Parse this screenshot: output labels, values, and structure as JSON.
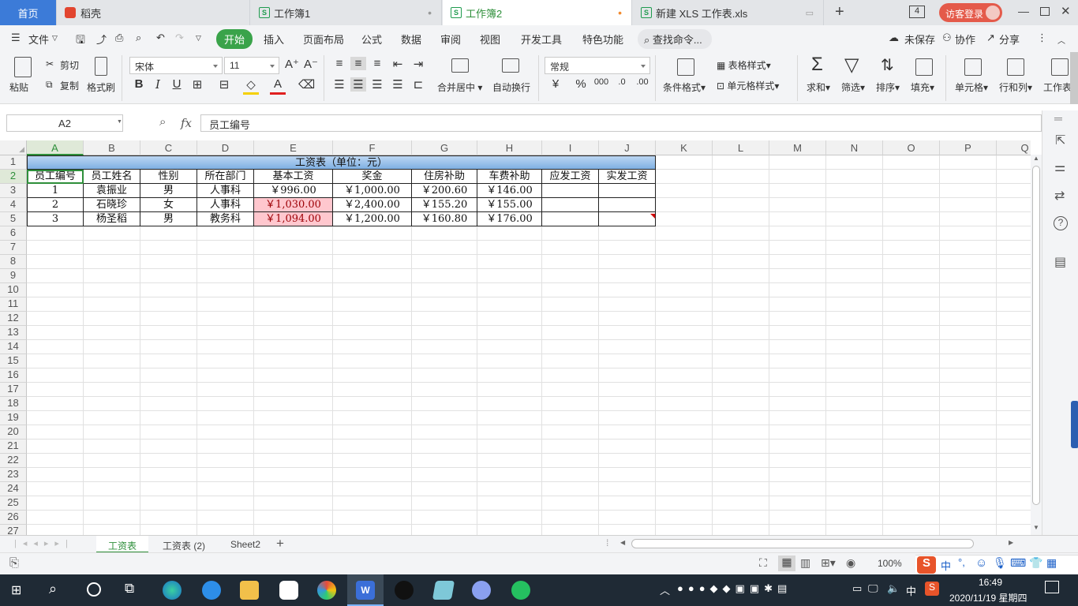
{
  "tabs": {
    "home": "首页",
    "daoke": "稻壳",
    "book1": "工作簿1",
    "book2": "工作簿2",
    "xls": "新建 XLS 工作表.xls",
    "plus": "+",
    "count": "4",
    "login": "访客登录"
  },
  "menu": {
    "file": "文件",
    "start": "开始",
    "insert": "插入",
    "layout": "页面布局",
    "formula": "公式",
    "data": "数据",
    "review": "审阅",
    "view": "视图",
    "dev": "开发工具",
    "special": "特色功能",
    "search": "查找命令...",
    "unsaved": "未保存",
    "collab": "协作",
    "share": "分享"
  },
  "ribbon": {
    "paste": "粘贴",
    "cut": "剪切",
    "copy": "复制",
    "painter": "格式刷",
    "font": "宋体",
    "size": "11",
    "merge": "合并居中",
    "wrap": "自动换行",
    "numfmt": "常规",
    "condfmt": "条件格式",
    "tablestyle": "表格样式",
    "cellstyle": "单元格样式",
    "sum": "求和",
    "filter": "筛选",
    "sort": "排序",
    "fill": "填充",
    "cell": "单元格",
    "rowcol": "行和列",
    "sheet": "工作表"
  },
  "formula_bar": {
    "name": "A2",
    "fx": "fx",
    "content": "员工编号"
  },
  "columns": [
    "A",
    "B",
    "C",
    "D",
    "E",
    "F",
    "G",
    "H",
    "I",
    "J",
    "K",
    "L",
    "M",
    "N",
    "O",
    "P",
    "Q"
  ],
  "rows": [
    "1",
    "2",
    "3",
    "4",
    "5",
    "6",
    "7",
    "8",
    "9",
    "10",
    "11",
    "12",
    "13",
    "14",
    "15",
    "16",
    "17",
    "18",
    "19",
    "20",
    "21",
    "22",
    "23",
    "24",
    "25",
    "26",
    "27"
  ],
  "table": {
    "title": "工资表（单位：元）",
    "headers": [
      "员工编号",
      "员工姓名",
      "性别",
      "所在部门",
      "基本工资",
      "奖金",
      "住房补助",
      "车费补助",
      "应发工资",
      "实发工资"
    ],
    "r3": [
      "1",
      "袁振业",
      "男",
      "人事科",
      "￥996.00",
      "￥1,000.00",
      "￥200.60",
      "￥146.00",
      "",
      ""
    ],
    "r4": [
      "2",
      "石晓珍",
      "女",
      "人事科",
      "￥1,030.00",
      "￥2,400.00",
      "￥155.20",
      "￥155.00",
      "",
      ""
    ],
    "r5": [
      "3",
      "杨圣稻",
      "男",
      "教务科",
      "￥1,094.00",
      "￥1,200.00",
      "￥160.80",
      "￥176.00",
      "",
      ""
    ]
  },
  "sheets": [
    "工资表",
    "工资表 (2)",
    "Sheet2"
  ],
  "status": {
    "zoom": "100%"
  },
  "taskbar": {
    "time": "16:49",
    "date": "2020/11/19 星期四",
    "ime": "中"
  }
}
